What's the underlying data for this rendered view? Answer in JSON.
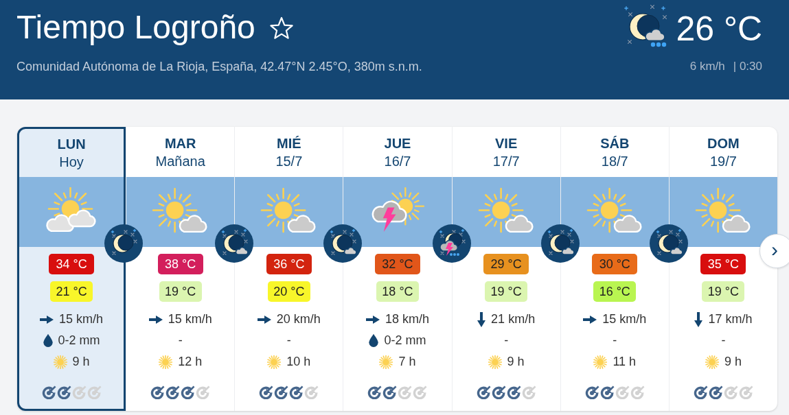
{
  "header": {
    "title": "Tiempo Logroño",
    "favorite": false,
    "subtitle": "Comunidad Autónoma de La Rioja, España, 42.47°N 2.45°O, 380m s.n.m.",
    "current": {
      "kind": "moon_rain",
      "temperature": "26 °C",
      "wind": "6 km/h",
      "time": "| 0:30"
    }
  },
  "days": [
    {
      "name": "LUN",
      "date": "Hoy",
      "selected": true,
      "day_weather": {
        "kind": "sun_clouds"
      },
      "night_weather": {
        "kind": "clear"
      },
      "max": {
        "text": "34 °C",
        "color": "#d80e0e"
      },
      "min": {
        "text": "21 °C",
        "color": "#f8f62a"
      },
      "wind": {
        "kind": "right",
        "text": "15 km/h"
      },
      "rain": {
        "kind": "drop",
        "text": "0-2 mm"
      },
      "sun": "9 h",
      "stars": 2
    },
    {
      "name": "MAR",
      "date": "Mañana",
      "selected": false,
      "day_weather": {
        "kind": "sun_cloud"
      },
      "night_weather": {
        "kind": "cloud"
      },
      "max": {
        "text": "38 °C",
        "color": "#d31f5c"
      },
      "min": {
        "text": "19 °C",
        "color": "#dbf5b0"
      },
      "wind": {
        "kind": "right",
        "text": "15 km/h"
      },
      "rain": {
        "kind": "none",
        "text": "-"
      },
      "sun": "12 h",
      "stars": 3
    },
    {
      "name": "MIÉ",
      "date": "15/7",
      "selected": false,
      "day_weather": {
        "kind": "sun_cloud"
      },
      "night_weather": {
        "kind": "cloud"
      },
      "max": {
        "text": "36 °C",
        "color": "#d3240f"
      },
      "min": {
        "text": "20 °C",
        "color": "#f8f62a"
      },
      "wind": {
        "kind": "right",
        "text": "20 km/h"
      },
      "rain": {
        "kind": "none",
        "text": "-"
      },
      "sun": "10 h",
      "stars": 3
    },
    {
      "name": "JUE",
      "date": "16/7",
      "selected": false,
      "day_weather": {
        "kind": "storm"
      },
      "night_weather": {
        "kind": "storm"
      },
      "max": {
        "text": "32 °C",
        "color": "#e1561a"
      },
      "min": {
        "text": "18 °C",
        "color": "#dbf5b0"
      },
      "wind": {
        "kind": "right",
        "text": "18 km/h"
      },
      "rain": {
        "kind": "drop",
        "text": "0-2 mm"
      },
      "sun": "7 h",
      "stars": 2
    },
    {
      "name": "VIE",
      "date": "17/7",
      "selected": false,
      "day_weather": {
        "kind": "sun_cloud"
      },
      "night_weather": {
        "kind": "cloud"
      },
      "max": {
        "text": "29 °C",
        "color": "#e7911f"
      },
      "min": {
        "text": "19 °C",
        "color": "#dbf5b0"
      },
      "wind": {
        "kind": "down",
        "text": "21 km/h"
      },
      "rain": {
        "kind": "none",
        "text": "-"
      },
      "sun": "9 h",
      "stars": 3
    },
    {
      "name": "SÁB",
      "date": "18/7",
      "selected": false,
      "day_weather": {
        "kind": "sun_cloud"
      },
      "night_weather": {
        "kind": "cloud"
      },
      "max": {
        "text": "30 °C",
        "color": "#e86b19"
      },
      "min": {
        "text": "16 °C",
        "color": "#b9f551"
      },
      "wind": {
        "kind": "right",
        "text": "15 km/h"
      },
      "rain": {
        "kind": "none",
        "text": "-"
      },
      "sun": "11 h",
      "stars": 2
    },
    {
      "name": "DOM",
      "date": "19/7",
      "selected": false,
      "day_weather": {
        "kind": "sun_cloud"
      },
      "max": {
        "text": "35 °C",
        "color": "#d80e0e"
      },
      "min": {
        "text": "19 °C",
        "color": "#dbf5b0"
      },
      "wind": {
        "kind": "down",
        "text": "17 km/h"
      },
      "rain": {
        "kind": "none",
        "text": "-"
      },
      "sun": "9 h",
      "stars": 2
    }
  ],
  "next_button": "›"
}
